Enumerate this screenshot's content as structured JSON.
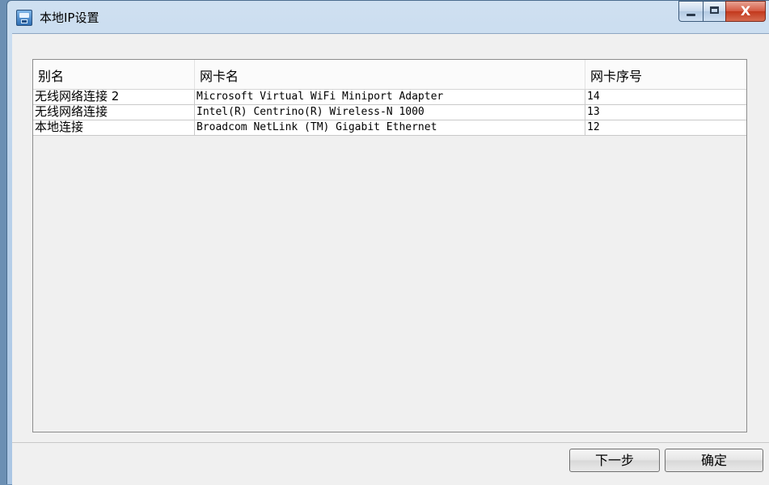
{
  "window": {
    "title": "本地IP设置",
    "close_glyph": "X"
  },
  "table": {
    "columns": [
      "别名",
      "网卡名",
      "网卡序号"
    ],
    "rows": [
      {
        "alias": "无线网络连接 2",
        "adapter": "Microsoft Virtual WiFi Miniport Adapter",
        "index": "14"
      },
      {
        "alias": "无线网络连接",
        "adapter": "Intel(R) Centrino(R) Wireless-N 1000",
        "index": "13"
      },
      {
        "alias": "本地连接",
        "adapter": "Broadcom NetLink (TM) Gigabit Ethernet",
        "index": "12"
      }
    ]
  },
  "buttons": {
    "next": "下一步",
    "ok": "确定"
  },
  "icons": {
    "app": "network-adapter-icon",
    "minimize": "minimize-icon",
    "maximize": "maximize-icon",
    "close": "close-icon"
  }
}
